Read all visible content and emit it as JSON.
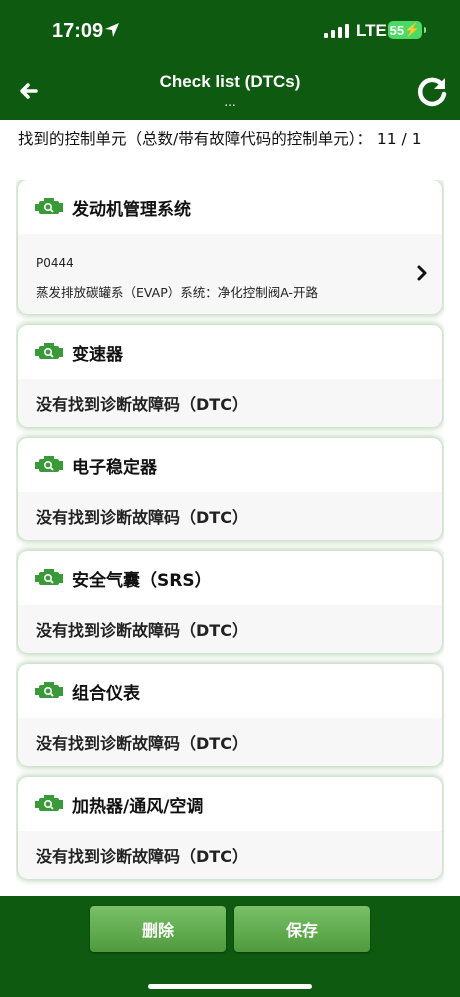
{
  "status": {
    "time": "17:09",
    "network": "LTE",
    "battery": "55"
  },
  "header": {
    "title": "Check list (DTCs)",
    "subtitle": "..."
  },
  "summary": "找到的控制单元（总数/带有故障代码的控制单元）： 11 / 1",
  "units": [
    {
      "name": "发动机管理系统",
      "dtc_code": "P0444",
      "dtc_desc": "蒸发排放碳罐系（EVAP）系统：净化控制阀A-开路"
    },
    {
      "name": "变速器",
      "status": "没有找到诊断故障码（DTC）"
    },
    {
      "name": "电子稳定器",
      "status": "没有找到诊断故障码（DTC）"
    },
    {
      "name": "安全气囊（SRS）",
      "status": "没有找到诊断故障码（DTC）"
    },
    {
      "name": "组合仪表",
      "status": "没有找到诊断故障码（DTC）"
    },
    {
      "name": "加热器/通风/空调",
      "status": "没有找到诊断故障码（DTC）"
    }
  ],
  "footer": {
    "delete_label": "删除",
    "save_label": "保存"
  },
  "colors": {
    "header_bg": "#0e5a10",
    "button": "#5fab4c",
    "icon": "#3a9a3a"
  }
}
